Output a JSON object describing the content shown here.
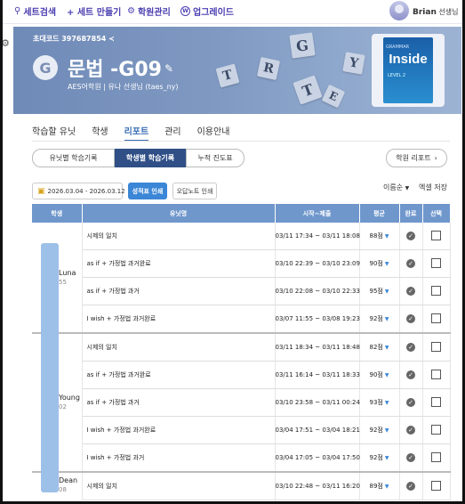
{
  "topnav": {
    "items": [
      {
        "icon": "search-icon",
        "glyph": "🔍",
        "label": "세트검색"
      },
      {
        "icon": "plus-icon",
        "glyph": "",
        "label": "+ 세트 만들기"
      },
      {
        "icon": "academy-icon",
        "glyph": "⚙",
        "label": "학원관리"
      },
      {
        "icon": "upgrade-icon",
        "glyph": "ⓦ",
        "label": "업그레이드"
      }
    ],
    "user_name": "Brian",
    "user_role": "선생님"
  },
  "banner": {
    "invite_code": "초대코드 397687854",
    "initial": "G",
    "set_title": "문법 -G09",
    "academy_line": "AES어학원 | 유나 선생님 (taes_ny)",
    "tiles": [
      "G",
      "R",
      "T",
      "T",
      "Y",
      "E"
    ],
    "book": {
      "series": "GRAMMAR",
      "title": "Inside",
      "level": "LEVEL 2"
    }
  },
  "tabs": [
    "학습할 유닛",
    "학생",
    "리포트",
    "관리",
    "이용안내"
  ],
  "active_tab": "리포트",
  "subtabs": [
    "유닛별 학습기록",
    "학생별 학습기록",
    "누적 진도표"
  ],
  "active_subtab": "학생별 학습기록",
  "academy_report_label": "학원 리포트",
  "filters": {
    "date_range": "2026.03.04 - 2026.03.12",
    "print_report": "성적표 인쇄",
    "print_wrong": "오답노트 인쇄",
    "sort": "이름순",
    "excel": "엑셀 저장"
  },
  "table": {
    "headers": [
      "학생",
      "유닛명",
      "시작~제출",
      "평균",
      "완료",
      "선택"
    ],
    "students": [
      {
        "name": "Luna",
        "num": "55"
      },
      {
        "name": "Young",
        "num": "02"
      },
      {
        "name": "Dean",
        "num": "08"
      }
    ],
    "rows": [
      {
        "unit": "시제의 일치",
        "time": "03/11 17:34 ~ 03/11 18:08",
        "avg": "88점",
        "arrow": true,
        "group_end": false
      },
      {
        "unit": "as if + 가정법 과거완료",
        "time": "03/10 22:39 ~ 03/10 23:09",
        "avg": "90점",
        "arrow": true,
        "group_end": false
      },
      {
        "unit": "as if + 가정법 과거",
        "time": "03/10 22:08 ~ 03/10 22:33",
        "avg": "95점",
        "arrow": true,
        "group_end": false
      },
      {
        "unit": "I wish + 가정법 과거완료",
        "time": "03/07 11:55 ~ 03/08 19:23",
        "avg": "92점",
        "arrow": true,
        "group_end": true
      },
      {
        "unit": "시제의 일치",
        "time": "03/11 18:34 ~ 03/11 18:48",
        "avg": "82점",
        "arrow": true,
        "group_end": false
      },
      {
        "unit": "as if + 가정법 과거완료",
        "time": "03/11 16:14 ~ 03/11 18:33",
        "avg": "90점",
        "arrow": true,
        "group_end": false
      },
      {
        "unit": "as if + 가정법 과거",
        "time": "03/10 23:58 ~ 03/11 00:24",
        "avg": "93점",
        "arrow": true,
        "group_end": false
      },
      {
        "unit": "I wish + 가정법 과거완료",
        "time": "03/04 17:51 ~ 03/04 18:21",
        "avg": "92점",
        "arrow": true,
        "group_end": false
      },
      {
        "unit": "I wish + 가정법 과거",
        "time": "03/04 17:05 ~ 03/04 17:50",
        "avg": "92점",
        "arrow": true,
        "group_end": true
      },
      {
        "unit": "시제의 일치",
        "time": "03/10 22:48 ~ 03/11 16:20",
        "avg": "89점",
        "arrow": true,
        "group_end": false
      }
    ]
  },
  "colors": {
    "accent": "#3b6fb6",
    "header_bg": "#6f97cc",
    "banner": "#7f99c2",
    "nav_text": "#4a3fb0"
  }
}
